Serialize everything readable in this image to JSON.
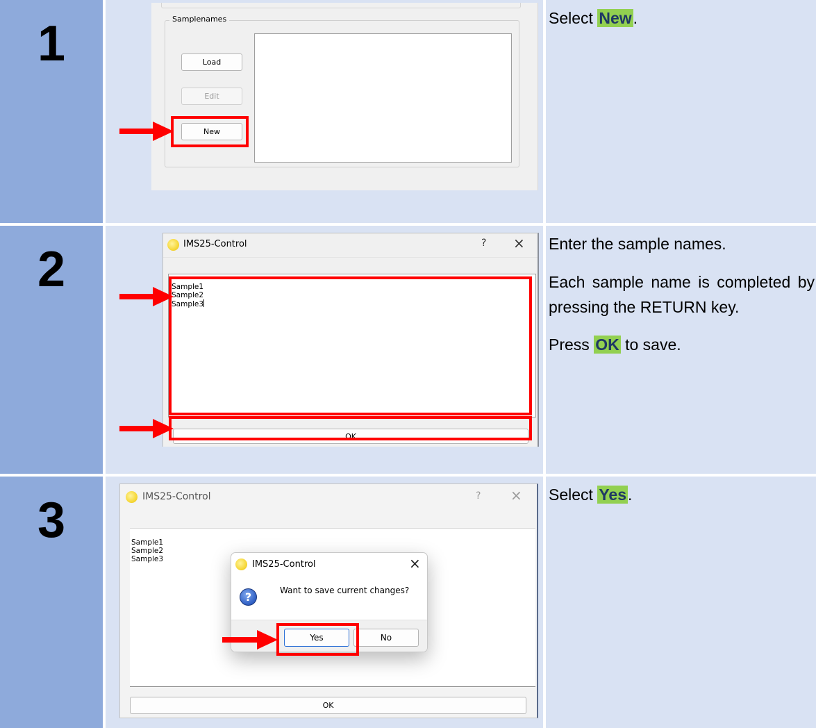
{
  "steps": [
    {
      "number": "1",
      "screenshot": {
        "group_title": "Samplenames",
        "buttons": {
          "load": "Load",
          "edit": "Edit",
          "new": "New"
        }
      },
      "instruction": {
        "prefix": "Select ",
        "highlight": "New",
        "suffix": "."
      }
    },
    {
      "number": "2",
      "screenshot": {
        "window_title": "IMS25-Control",
        "help_glyph": "?",
        "close_glyph": "×",
        "lines": [
          "Sample1",
          "Sample2",
          "Sample3"
        ],
        "ok_label": "OK"
      },
      "instruction": {
        "line1": "Enter the sample names.",
        "line2": "Each sample name is completed by pressing the RETURN key.",
        "line3_prefix": "Press ",
        "line3_highlight": "OK",
        "line3_suffix": " to save."
      }
    },
    {
      "number": "3",
      "screenshot": {
        "window_title": "IMS25-Control",
        "help_glyph": "?",
        "close_glyph": "×",
        "lines": [
          "Sample1",
          "Sample2",
          "Sample3"
        ],
        "ok_label": "OK",
        "dialog": {
          "title": "IMS25-Control",
          "close_glyph": "×",
          "message": "Want to save current changes?",
          "question_glyph": "?",
          "yes": "Yes",
          "no": "No"
        }
      },
      "instruction": {
        "prefix": "Select ",
        "highlight": "Yes",
        "suffix": "."
      }
    }
  ],
  "colors": {
    "number_cell": "#8eaadb",
    "content_cell": "#d9e2f3",
    "highlight": "#92d050",
    "highlight_text": "#1f3864",
    "marker_red": "#ff0000"
  }
}
